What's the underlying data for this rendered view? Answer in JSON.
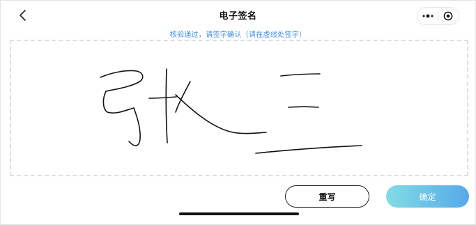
{
  "nav": {
    "title": "电子签名",
    "back_icon": "chevron-left-icon",
    "menu_icon": "more-dots-icon",
    "close_icon": "target-circle-icon"
  },
  "hint": "核验通过，请签字确认（请在虚线处签字）",
  "signature_pad": {
    "border_color": "#dedede",
    "ink_color": "#111111"
  },
  "buttons": {
    "rewrite_label": "重写",
    "confirm_label": "确定"
  },
  "colors": {
    "hint": "#3d8ee6",
    "confirm_gradient_start": "#82dce6",
    "confirm_gradient_end": "#56a9e8"
  }
}
